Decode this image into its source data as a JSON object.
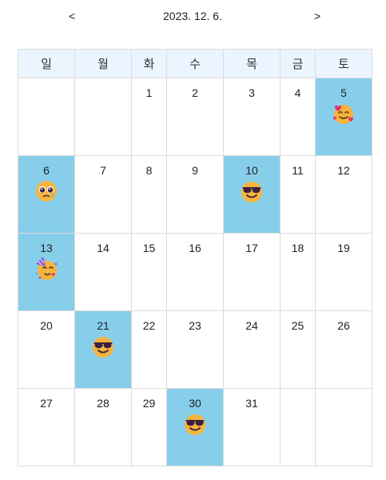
{
  "nav": {
    "prev_label": "<",
    "next_label": ">",
    "current_date": "2023. 12. 6."
  },
  "weekdays": [
    "일",
    "월",
    "화",
    "수",
    "목",
    "금",
    "토"
  ],
  "colors": {
    "highlight": "#87ceeb",
    "header_bg": "#eaf5ff",
    "emoji_face": "#f7b43c"
  },
  "weeks": [
    [
      {
        "day": ""
      },
      {
        "day": ""
      },
      {
        "day": "1"
      },
      {
        "day": "2"
      },
      {
        "day": "3"
      },
      {
        "day": "4"
      },
      {
        "day": "5",
        "hl": true,
        "emoji": "smiling-face-with-hearts"
      }
    ],
    [
      {
        "day": "6",
        "hl": true,
        "emoji": "pleading-face"
      },
      {
        "day": "7"
      },
      {
        "day": "8"
      },
      {
        "day": "9"
      },
      {
        "day": "10",
        "hl": true,
        "emoji": "sunglasses-face"
      },
      {
        "day": "11"
      },
      {
        "day": "12"
      }
    ],
    [
      {
        "day": "13",
        "hl": true,
        "emoji": "partying-face"
      },
      {
        "day": "14"
      },
      {
        "day": "15"
      },
      {
        "day": "16"
      },
      {
        "day": "17"
      },
      {
        "day": "18"
      },
      {
        "day": "19"
      }
    ],
    [
      {
        "day": "20"
      },
      {
        "day": "21",
        "hl": true,
        "emoji": "sunglasses-face"
      },
      {
        "day": "22"
      },
      {
        "day": "23"
      },
      {
        "day": "24"
      },
      {
        "day": "25"
      },
      {
        "day": "26"
      }
    ],
    [
      {
        "day": "27"
      },
      {
        "day": "28"
      },
      {
        "day": "29"
      },
      {
        "day": "30",
        "hl": true,
        "emoji": "sunglasses-face"
      },
      {
        "day": "31"
      },
      {
        "day": ""
      },
      {
        "day": ""
      }
    ]
  ]
}
